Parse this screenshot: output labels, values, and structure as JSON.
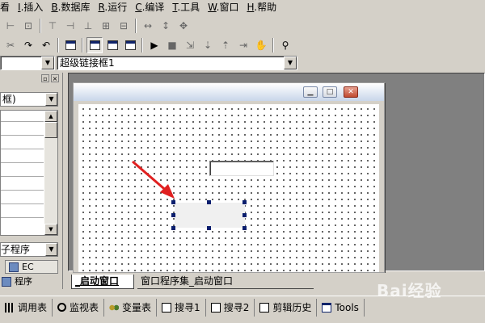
{
  "menu": [
    {
      "pre": "",
      "acc": "",
      "rest": "看"
    },
    {
      "pre": "",
      "acc": "I",
      "rest": ".插入"
    },
    {
      "pre": "",
      "acc": "B",
      "rest": ".数据库"
    },
    {
      "pre": "",
      "acc": "R",
      "rest": ".运行"
    },
    {
      "pre": "",
      "acc": "C",
      "rest": ".编译"
    },
    {
      "pre": "",
      "acc": "T",
      "rest": ".工具"
    },
    {
      "pre": "",
      "acc": "W",
      "rest": ".窗口"
    },
    {
      "pre": "",
      "acc": "H",
      "rest": ".帮助"
    }
  ],
  "combo_left": {
    "value": ""
  },
  "combo_main": {
    "value": "超级链接框1"
  },
  "left_panel": {
    "combo_top_value": "框)",
    "combo_bottom_value": "子程序",
    "tab_ec_label": "EC",
    "tab_program_label": "程序"
  },
  "doc_tabs": {
    "active": "_启动窗口",
    "other": "窗口程序集_启动窗口"
  },
  "tool_tabs": [
    {
      "label": "调用表",
      "icon": "grid-icon"
    },
    {
      "label": "监视表",
      "icon": "magnifier-icon"
    },
    {
      "label": "变量表",
      "icon": "variables-icon"
    },
    {
      "label": "搜寻1",
      "icon": "search-results-icon"
    },
    {
      "label": "搜寻2",
      "icon": "search-results-icon"
    },
    {
      "label": "剪辑历史",
      "icon": "clipboard-icon"
    },
    {
      "label": "Tools",
      "icon": "window-icon"
    }
  ],
  "watermark": "Bai经验",
  "colors": {
    "face": "#d4d0c8",
    "mdi_bg": "#808080",
    "arrow": "#e02020",
    "handle": "#0a1e6e"
  }
}
